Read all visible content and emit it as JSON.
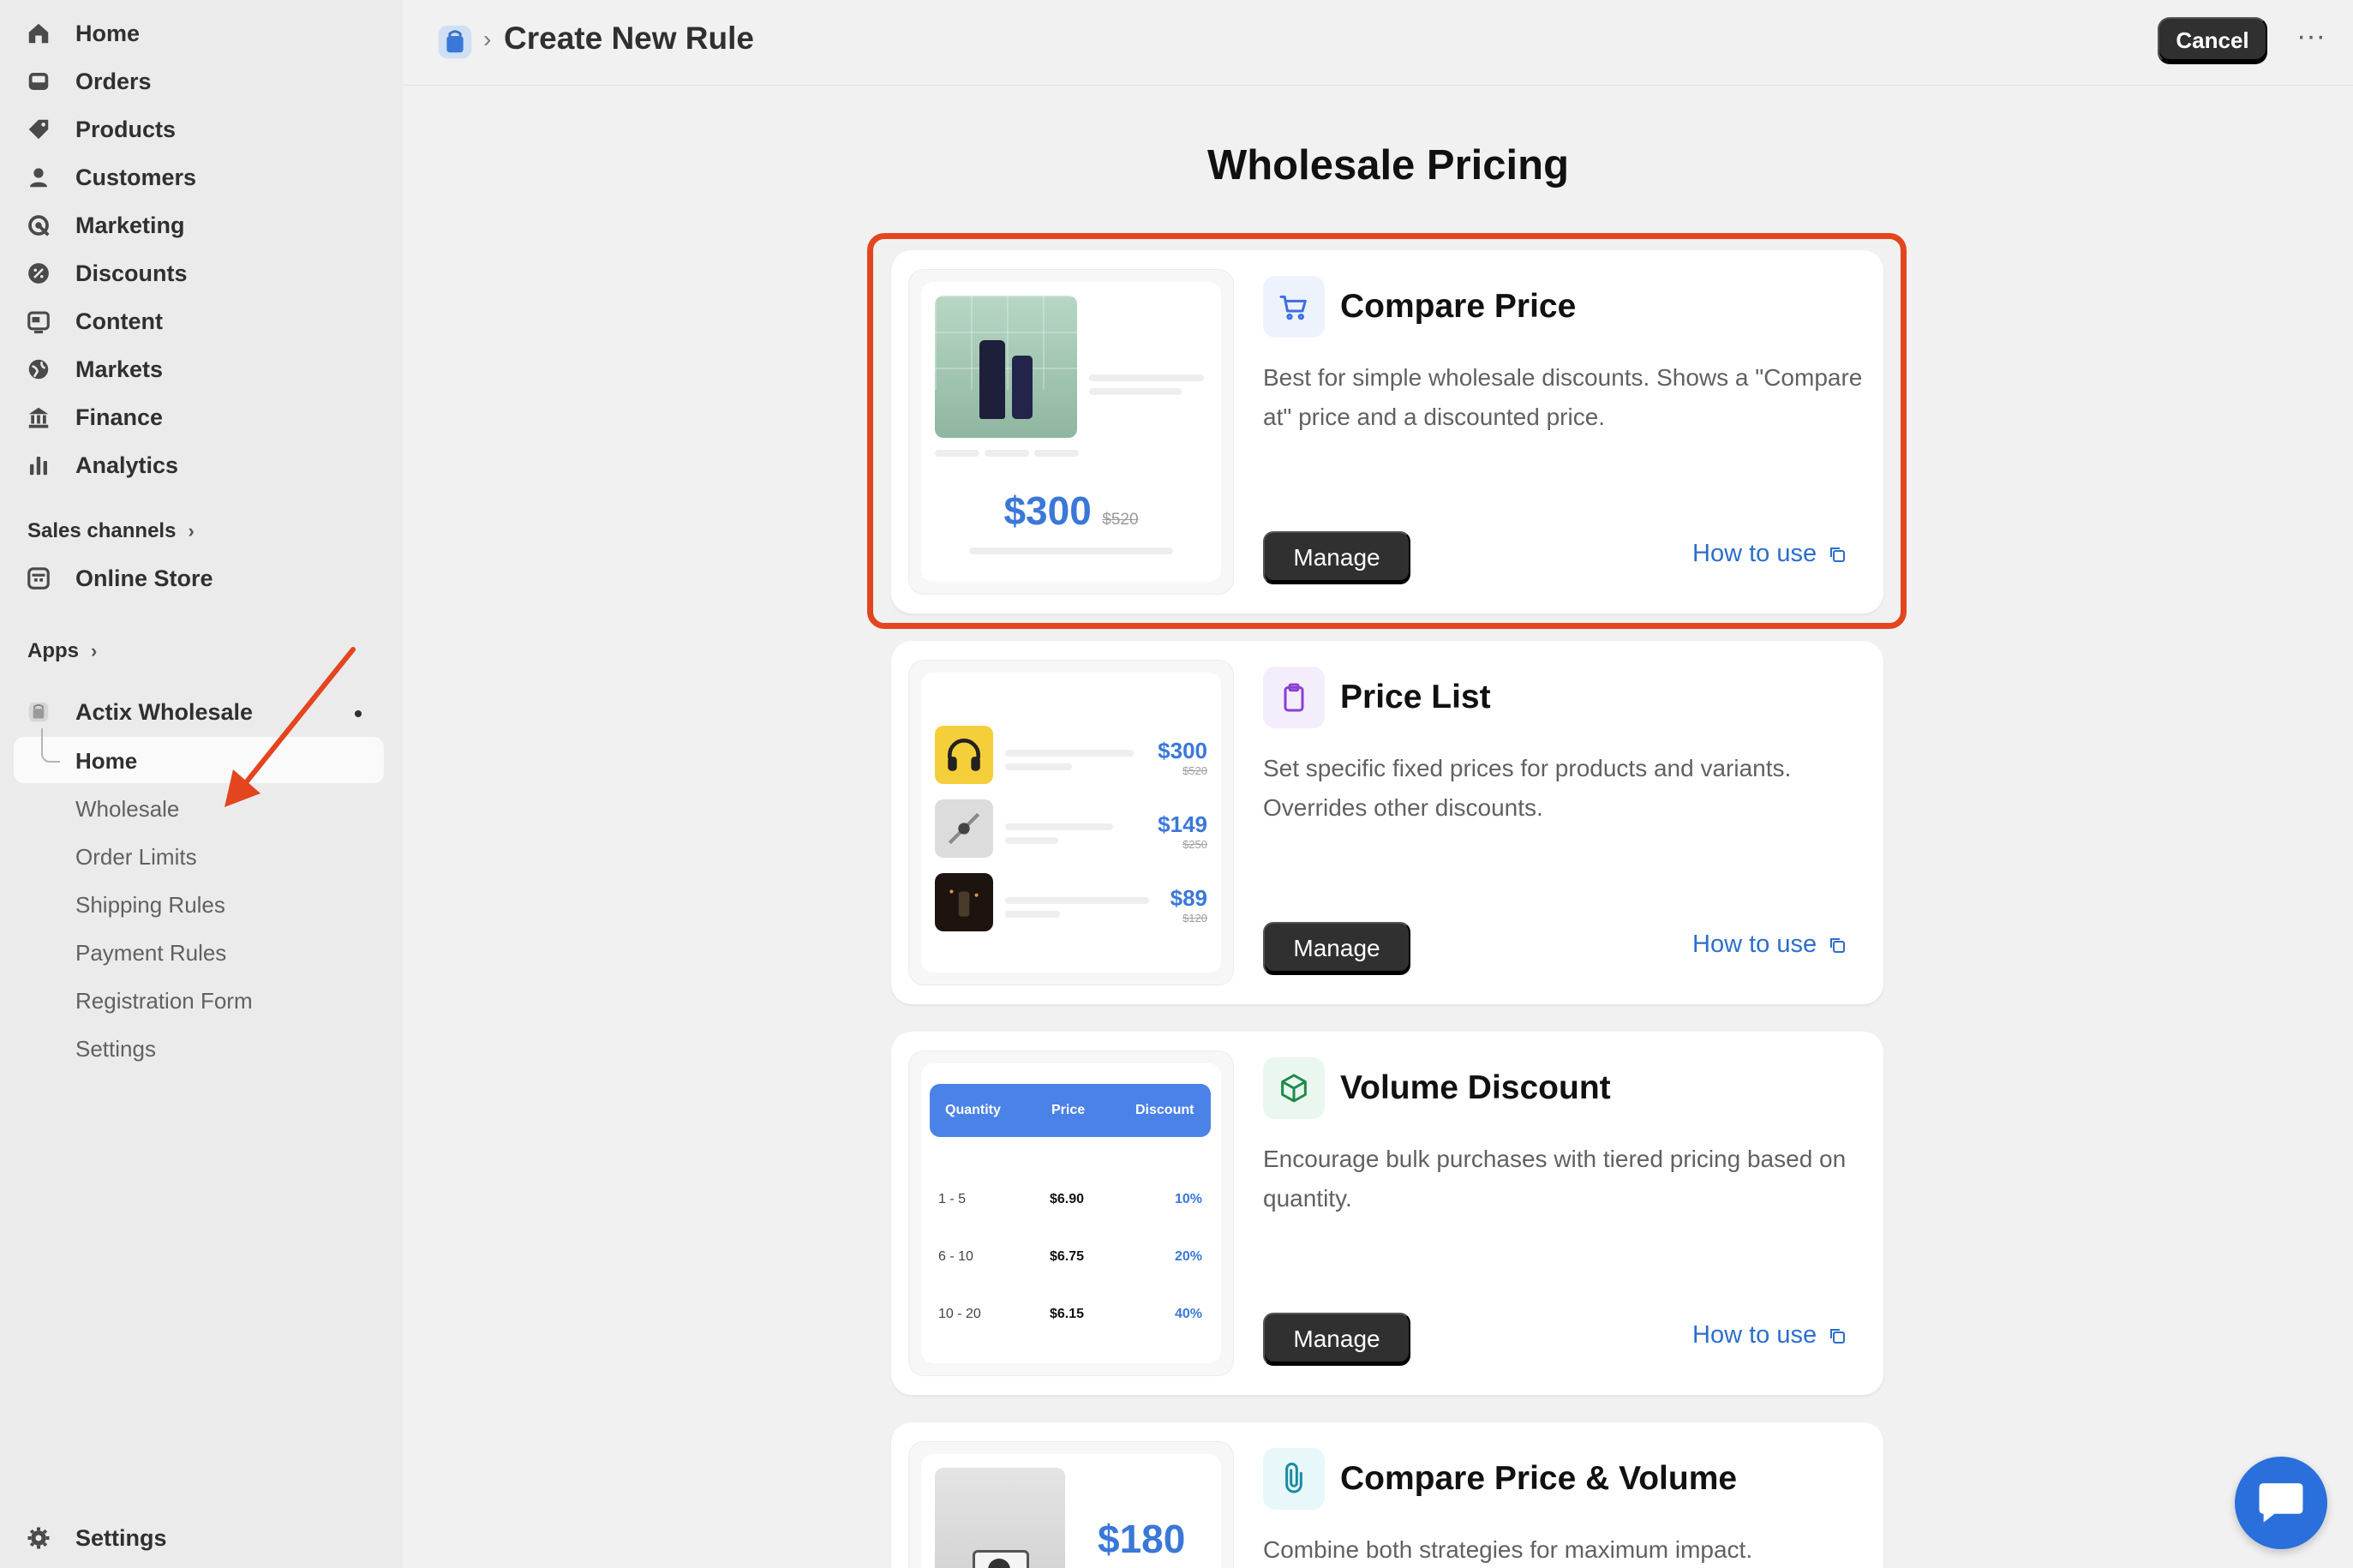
{
  "sidebar": {
    "nav": [
      {
        "label": "Home",
        "icon": "home-icon"
      },
      {
        "label": "Orders",
        "icon": "inbox-icon"
      },
      {
        "label": "Products",
        "icon": "tag-icon"
      },
      {
        "label": "Customers",
        "icon": "person-icon"
      },
      {
        "label": "Marketing",
        "icon": "target-icon"
      },
      {
        "label": "Discounts",
        "icon": "discount-icon"
      },
      {
        "label": "Content",
        "icon": "content-icon"
      },
      {
        "label": "Markets",
        "icon": "globe-icon"
      },
      {
        "label": "Finance",
        "icon": "bank-icon"
      },
      {
        "label": "Analytics",
        "icon": "bar-chart-icon"
      }
    ],
    "sales_channels_label": "Sales channels",
    "online_store_label": "Online Store",
    "apps_label": "Apps",
    "app_name": "Actix Wholesale",
    "app_items": [
      "Home",
      "Wholesale",
      "Order Limits",
      "Shipping Rules",
      "Payment Rules",
      "Registration Form",
      "Settings"
    ],
    "settings_label": "Settings"
  },
  "topbar": {
    "breadcrumb_sep": "›",
    "title": "Create New Rule",
    "cancel_label": "Cancel",
    "more_label": "···"
  },
  "main": {
    "title": "Wholesale Pricing",
    "cards": [
      {
        "title": "Compare Price",
        "description": "Best for simple wholesale discounts. Shows a \"Compare at\" price and a discounted price.",
        "manage_label": "Manage",
        "how_label": "How to use",
        "icon": "cart-icon",
        "preview": {
          "price": "$300",
          "compare": "$520"
        }
      },
      {
        "title": "Price List",
        "description": "Set specific fixed prices for products and variants. Overrides other discounts.",
        "manage_label": "Manage",
        "how_label": "How to use",
        "icon": "clipboard-icon",
        "preview": [
          {
            "price": "$300",
            "compare": "$520"
          },
          {
            "price": "$149",
            "compare": "$250"
          },
          {
            "price": "$89",
            "compare": "$120"
          }
        ]
      },
      {
        "title": "Volume Discount",
        "description": "Encourage bulk purchases with tiered pricing based on quantity.",
        "manage_label": "Manage",
        "how_label": "How to use",
        "icon": "box-icon",
        "preview": {
          "headers": [
            "Quantity",
            "Price",
            "Discount"
          ],
          "rows": [
            [
              "1 - 5",
              "$6.90",
              "10%"
            ],
            [
              "6 - 10",
              "$6.75",
              "20%"
            ],
            [
              "10 - 20",
              "$6.15",
              "40%"
            ]
          ]
        }
      },
      {
        "title": "Compare Price & Volume",
        "description": "Combine both strategies for maximum impact.",
        "icon": "link-icon",
        "preview": {
          "price": "$180"
        }
      }
    ]
  },
  "colors": {
    "accent_blue": "#2c6ecb",
    "highlight_red": "#e3451f",
    "button_dark": "#303030"
  }
}
